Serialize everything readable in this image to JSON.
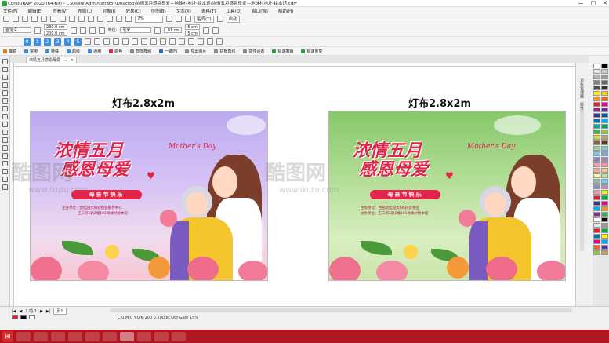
{
  "window": {
    "title": "CorelDRAW 2020 (64-Bit) - C:\\Users\\Administrator\\Desktop\\浓情五月感恩母爱—地球村地址-绘本馆\\浓情五月感恩母爱—地球村地址-绘本馆.cdr*",
    "controls": [
      "—",
      "□",
      "✕"
    ]
  },
  "menu": [
    "文件(F)",
    "编辑(E)",
    "查看(V)",
    "布局(L)",
    "对象(J)",
    "效果(C)",
    "位图(B)",
    "文本(X)",
    "表格(T)",
    "工具(O)",
    "窗口(W)",
    "帮助(H)"
  ],
  "toolbar": {
    "zoom": "7%",
    "snap_label": "贴齐(T)",
    "launch_label": "启动"
  },
  "propbar": {
    "preset": "自定义",
    "width": "280.0 cm",
    "height": "200.0 cm",
    "units_label": "单位:",
    "units": "毫米",
    "nudge": ".01 cm",
    "dup_x": "5 cm",
    "dup_y": "5 cm"
  },
  "plugins": [
    "魔镜",
    "常用",
    "特殊",
    "超级",
    "通用",
    "颜色",
    "智能群组",
    "一键PS",
    "导出图片",
    "拼板角线",
    "插件设置",
    "极速撤销",
    "极速重复"
  ],
  "document_tab": "浓情五月感恩母爱—...",
  "canvas": {
    "labels": [
      "灯布2.8x2m",
      "灯布2.8x2m"
    ],
    "poster": {
      "headline_1": "浓情五月",
      "headline_2": "感恩母爱",
      "script": "Mother's Day",
      "ribbon": "母亲节快乐"
    },
    "poster_purple": {
      "info_1": "主办单位：碧桂园太阳城物业服务中心",
      "info_2": "王三湾1路2幢101地球村绘本馆"
    },
    "poster_green": {
      "info_1": "主办单位：西部碧桂园太阳城A区物业",
      "info_2": "协办单位：王三湾1路2幢101地球村绘本馆"
    },
    "watermarks": [
      "酷图网",
      "酷图网"
    ],
    "watermark_small": [
      "www.ikutu.com",
      "www.ikutu.com"
    ]
  },
  "right_panels": [
    "对象管理器",
    "属性管理器"
  ],
  "statusbar": {
    "page_nav": "1 的 1",
    "page_tab": "页1",
    "status": "C:0 M:0 Y:0 K:100  0.200 pt  Dot Gain 15%"
  },
  "colors": {
    "accent": "#e0244a",
    "taskbar": "#b01622",
    "poster_purple": "#bcaaf0",
    "poster_green": "#86c86a"
  },
  "palette_colors": [
    "#ffffff",
    "#000000",
    "#e6e6e6",
    "#cccccc",
    "#b3b3b3",
    "#999999",
    "#808080",
    "#666666",
    "#4d4d4d",
    "#333333",
    "#fff200",
    "#ffd200",
    "#f7941d",
    "#f26522",
    "#ed1c24",
    "#ec008c",
    "#92278f",
    "#662d91",
    "#2e3192",
    "#0054a6",
    "#0072bc",
    "#00aeef",
    "#00a99d",
    "#00a651",
    "#39b54a",
    "#8dc63f",
    "#d7df23",
    "#c69c6d",
    "#8c6239",
    "#603913",
    "#a3d39c",
    "#7accc8",
    "#6dcff6",
    "#7da7d9",
    "#8781bd",
    "#a186be",
    "#f49ac1",
    "#f6989d",
    "#fbad82",
    "#fdc689",
    "#fff799",
    "#c4df9b",
    "#82ca9c",
    "#6ecff6",
    "#8393ca",
    "#bd8cbf",
    "#f5989d",
    "#fff200",
    "#ed1c24",
    "#00a651",
    "#2e3192",
    "#ec008c",
    "#00aeef",
    "#f7941d",
    "#92278f",
    "#39b54a",
    "#ffffff",
    "#000000",
    "#e6e6e6",
    "#999999",
    "#ed1c24",
    "#00a651",
    "#0072bc",
    "#fff200",
    "#ec008c",
    "#00aeef",
    "#f26522",
    "#662d91",
    "#8dc63f",
    "#c69c6d"
  ]
}
